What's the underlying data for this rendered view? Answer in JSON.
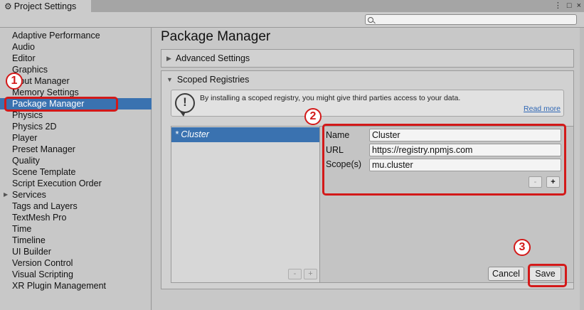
{
  "window": {
    "title": "Project Settings",
    "controls": [
      "⋮",
      "□",
      "×"
    ]
  },
  "search": {
    "placeholder": ""
  },
  "sidebar": {
    "items": [
      {
        "label": "Adaptive Performance"
      },
      {
        "label": "Audio"
      },
      {
        "label": "Editor"
      },
      {
        "label": "Graphics"
      },
      {
        "label": "Input Manager"
      },
      {
        "label": "Memory Settings"
      },
      {
        "label": "Package Manager",
        "selected": true
      },
      {
        "label": "Physics"
      },
      {
        "label": "Physics 2D"
      },
      {
        "label": "Player"
      },
      {
        "label": "Preset Manager"
      },
      {
        "label": "Quality"
      },
      {
        "label": "Scene Template"
      },
      {
        "label": "Script Execution Order"
      },
      {
        "label": "Services",
        "expandable": true
      },
      {
        "label": "Tags and Layers"
      },
      {
        "label": "TextMesh Pro"
      },
      {
        "label": "Time"
      },
      {
        "label": "Timeline"
      },
      {
        "label": "UI Builder"
      },
      {
        "label": "Version Control"
      },
      {
        "label": "Visual Scripting"
      },
      {
        "label": "XR Plugin Management"
      }
    ]
  },
  "main": {
    "title": "Package Manager",
    "advanced": {
      "label": "Advanced Settings",
      "expanded": false
    },
    "scoped": {
      "label": "Scoped Registries",
      "expanded": true,
      "warning": "By installing a scoped registry, you might give third parties access to your data.",
      "read_more": "Read more",
      "registry_item": "* Cluster",
      "list_remove": "-",
      "list_add": "+",
      "name_label": "Name",
      "name_value": "Cluster",
      "url_label": "URL",
      "url_value": "https://registry.npmjs.com",
      "scope_label": "Scope(s)",
      "scope_value": "mu.cluster",
      "scope_remove": "-",
      "scope_add": "+",
      "cancel": "Cancel",
      "save": "Save"
    }
  },
  "annotations": {
    "step1": "1",
    "step2": "2",
    "step3": "3",
    "color": "#d31919"
  },
  "colors": {
    "selection": "#3a72b0",
    "link": "#2f67b4"
  }
}
